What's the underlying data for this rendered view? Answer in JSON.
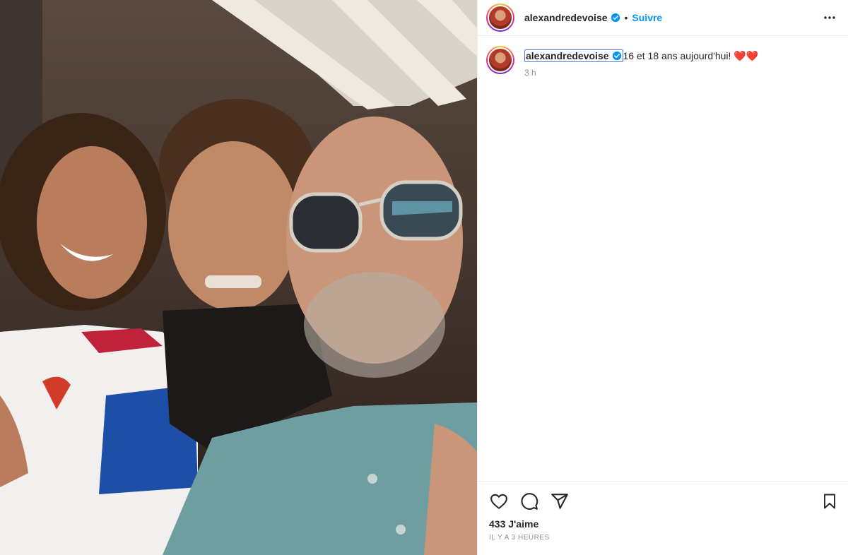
{
  "post": {
    "username": "alexandredevoise",
    "verified": true,
    "follow_label": "Suivre",
    "separator": "•",
    "caption_text": "16 et 18 ans aujourd'hui! ❤️❤️",
    "caption_time": "3 h",
    "likes": "433 J'aime",
    "posted_ago": "IL Y A 3 HEURES",
    "photo": "selfie of three people, man with sunglasses and two smiling teenagers"
  },
  "icons": {
    "more": "more-options-icon",
    "like": "heart-icon",
    "comment": "comment-icon",
    "share": "paper-plane-icon",
    "save": "bookmark-icon",
    "verified": "verified-badge-icon"
  },
  "colors": {
    "accent": "#0095f6",
    "text": "#262626",
    "muted": "#8e8e8e"
  }
}
